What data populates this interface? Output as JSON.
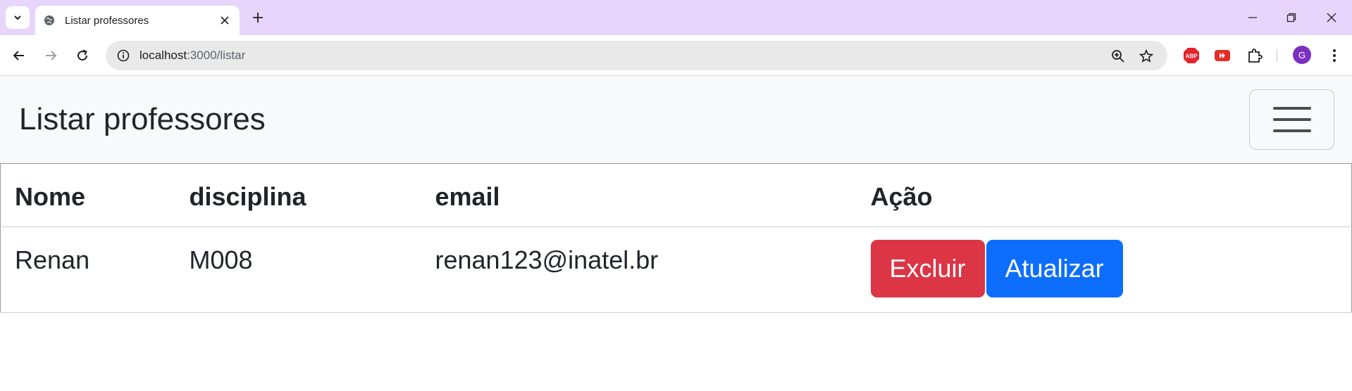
{
  "browser": {
    "tab_title": "Listar professores",
    "url_host": "localhost",
    "url_path": ":3000/listar",
    "profile_initial": "G",
    "extensions": [
      "adblock-plus-icon",
      "youtube-extension-icon",
      "extensions-puzzle-icon"
    ]
  },
  "page": {
    "title": "Listar professores"
  },
  "table": {
    "headers": [
      "Nome",
      "disciplina",
      "email",
      "Ação"
    ],
    "rows": [
      {
        "nome": "Renan",
        "disciplina": "M008",
        "email": "renan123@inatel.br"
      }
    ],
    "actions": {
      "delete_label": "Excluir",
      "update_label": "Atualizar"
    }
  },
  "colors": {
    "tabstrip": "#e8d5fb",
    "danger": "#dc3545",
    "primary": "#0d6efd",
    "navbar_bg": "#f8f9fa"
  }
}
